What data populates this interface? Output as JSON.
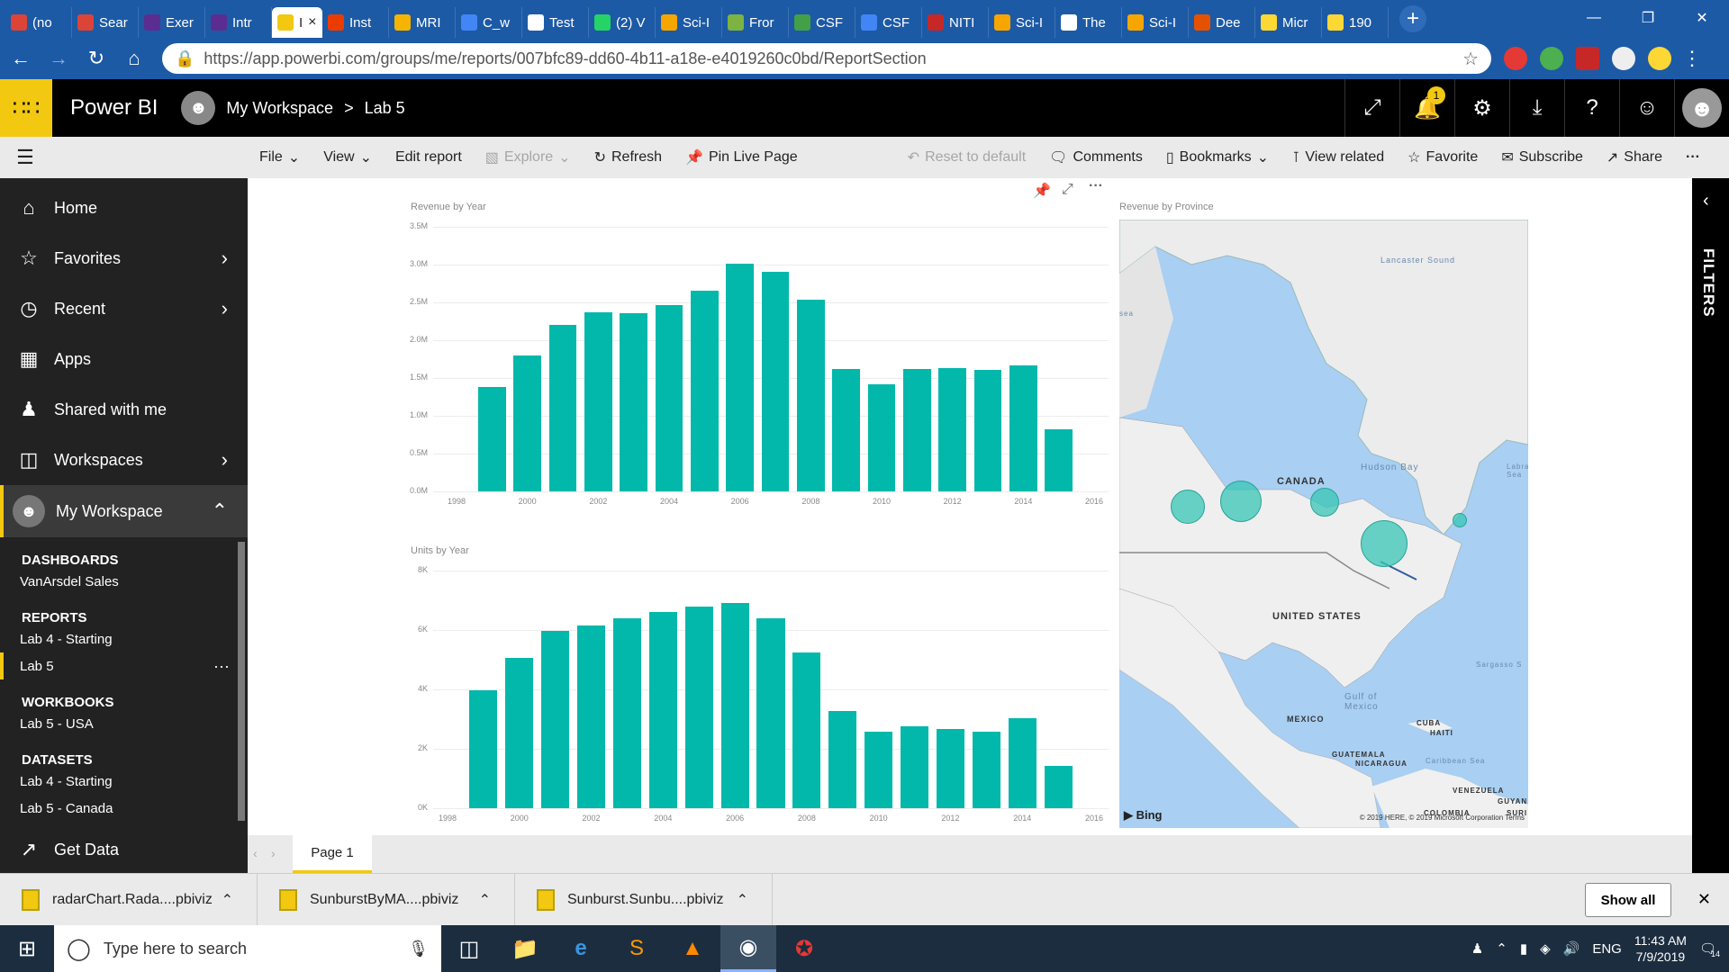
{
  "browser": {
    "tabs": [
      {
        "label": "(no",
        "color": "#db4437"
      },
      {
        "label": "Sear",
        "color": "#db4437"
      },
      {
        "label": "Exer",
        "color": "#5c2d91"
      },
      {
        "label": "Intr",
        "color": "#5c2d91"
      },
      {
        "label": "I",
        "color": "#f2c811",
        "active": true
      },
      {
        "label": "Inst",
        "color": "#eb3c00"
      },
      {
        "label": "MRI",
        "color": "#f4b400"
      },
      {
        "label": "C_w",
        "color": "#4285f4"
      },
      {
        "label": "Test",
        "color": "#ffffff"
      },
      {
        "label": "(2) V",
        "color": "#25d366"
      },
      {
        "label": "Sci-I",
        "color": "#f7a600"
      },
      {
        "label": "Fror",
        "color": "#7cb342"
      },
      {
        "label": "CSF",
        "color": "#43a047"
      },
      {
        "label": "CSF",
        "color": "#4285f4"
      },
      {
        "label": "NITI",
        "color": "#c62828"
      },
      {
        "label": "Sci-I",
        "color": "#f7a600"
      },
      {
        "label": "The",
        "color": "#ffffff"
      },
      {
        "label": "Sci-I",
        "color": "#f7a600"
      },
      {
        "label": "Dee",
        "color": "#e65100"
      },
      {
        "label": "Micr",
        "color": "#fdd835"
      },
      {
        "label": "190",
        "color": "#fdd835"
      }
    ],
    "url": "https://app.powerbi.com/groups/me/reports/007bfc89-dd60-4b11-a18e-e4019260c0bd/ReportSection"
  },
  "header": {
    "brand": "Power BI",
    "workspace": "My Workspace",
    "separator": ">",
    "report": "Lab 5",
    "notifications": "1"
  },
  "commands": {
    "file": "File",
    "view": "View",
    "edit": "Edit report",
    "explore": "Explore",
    "refresh": "Refresh",
    "pin": "Pin Live Page",
    "reset": "Reset to default",
    "comments": "Comments",
    "bookmarks": "Bookmarks",
    "related": "View related",
    "favorite": "Favorite",
    "subscribe": "Subscribe",
    "share": "Share",
    "more": "···"
  },
  "nav": {
    "home": "Home",
    "favorites": "Favorites",
    "recent": "Recent",
    "apps": "Apps",
    "shared": "Shared with me",
    "workspaces": "Workspaces",
    "myworkspace": "My Workspace",
    "sections": [
      {
        "title": "DASHBOARDS",
        "items": [
          "VanArsdel Sales"
        ]
      },
      {
        "title": "REPORTS",
        "items": [
          "Lab 4 - Starting",
          "Lab 5"
        ]
      },
      {
        "title": "WORKBOOKS",
        "items": [
          "Lab 5 - USA"
        ]
      },
      {
        "title": "DATASETS",
        "items": [
          "Lab 4 - Starting",
          "Lab 5 - Canada"
        ]
      }
    ],
    "getdata": "Get Data"
  },
  "chart_data": [
    {
      "type": "bar",
      "title": "Revenue by Year",
      "xticks": [
        "1998",
        "2000",
        "2002",
        "2004",
        "2006",
        "2008",
        "2010",
        "2012",
        "2014",
        "2016"
      ],
      "yticks": [
        "0.0M",
        "0.5M",
        "1.0M",
        "1.5M",
        "2.0M",
        "2.5M",
        "3.0M",
        "3.5M"
      ],
      "ylim": [
        0,
        3.5
      ],
      "x": [
        1999,
        2000,
        2001,
        2002,
        2003,
        2004,
        2005,
        2006,
        2007,
        2008,
        2009,
        2010,
        2011,
        2012,
        2013,
        2014,
        2015
      ],
      "values": [
        1.38,
        1.8,
        2.2,
        2.37,
        2.36,
        2.47,
        2.66,
        3.01,
        2.91,
        2.53,
        1.62,
        1.42,
        1.62,
        1.63,
        1.61,
        1.67,
        0.82
      ]
    },
    {
      "type": "bar",
      "title": "Units by Year",
      "xticks": [
        "1998",
        "2000",
        "2002",
        "2004",
        "2006",
        "2008",
        "2010",
        "2012",
        "2014",
        "2016"
      ],
      "yticks": [
        "0K",
        "2K",
        "4K",
        "6K",
        "8K"
      ],
      "ylim": [
        0,
        8
      ],
      "x": [
        1999,
        2000,
        2001,
        2002,
        2003,
        2004,
        2005,
        2006,
        2007,
        2008,
        2009,
        2010,
        2011,
        2012,
        2013,
        2014,
        2015
      ],
      "values": [
        3.98,
        5.05,
        5.98,
        6.16,
        6.39,
        6.61,
        6.78,
        6.91,
        6.38,
        5.24,
        3.27,
        2.58,
        2.75,
        2.67,
        2.57,
        3.03,
        1.41
      ]
    }
  ],
  "map": {
    "title": "Revenue by Province",
    "labels": [
      "Lancaster Sound",
      "Hudson Bay",
      "CANADA",
      "UNITED STATES",
      "Gulf of Mexico",
      "MEXICO",
      "CUBA",
      "HAITI",
      "GUATEMALA",
      "NICARAGUA",
      "Caribbean Sea",
      "VENEZUELA",
      "COLOMBIA",
      "GUYAN",
      "SURI",
      "Sargasso S",
      "Labrad Sea",
      "sea"
    ],
    "provider": "Bing",
    "copyright": "© 2019 HERE, © 2019 Microsoft Corporation  Terms"
  },
  "page": {
    "tab": "Page 1"
  },
  "filters": {
    "label": "FILTERS"
  },
  "downloads": {
    "items": [
      "radarChart.Rada....pbiviz",
      "SunburstByMA....pbiviz",
      "Sunburst.Sunbu....pbiviz"
    ],
    "showall": "Show all"
  },
  "taskbar": {
    "search": "Type here to search",
    "lang": "ENG",
    "time": "11:43 AM",
    "date": "7/9/2019",
    "notif": "14"
  }
}
